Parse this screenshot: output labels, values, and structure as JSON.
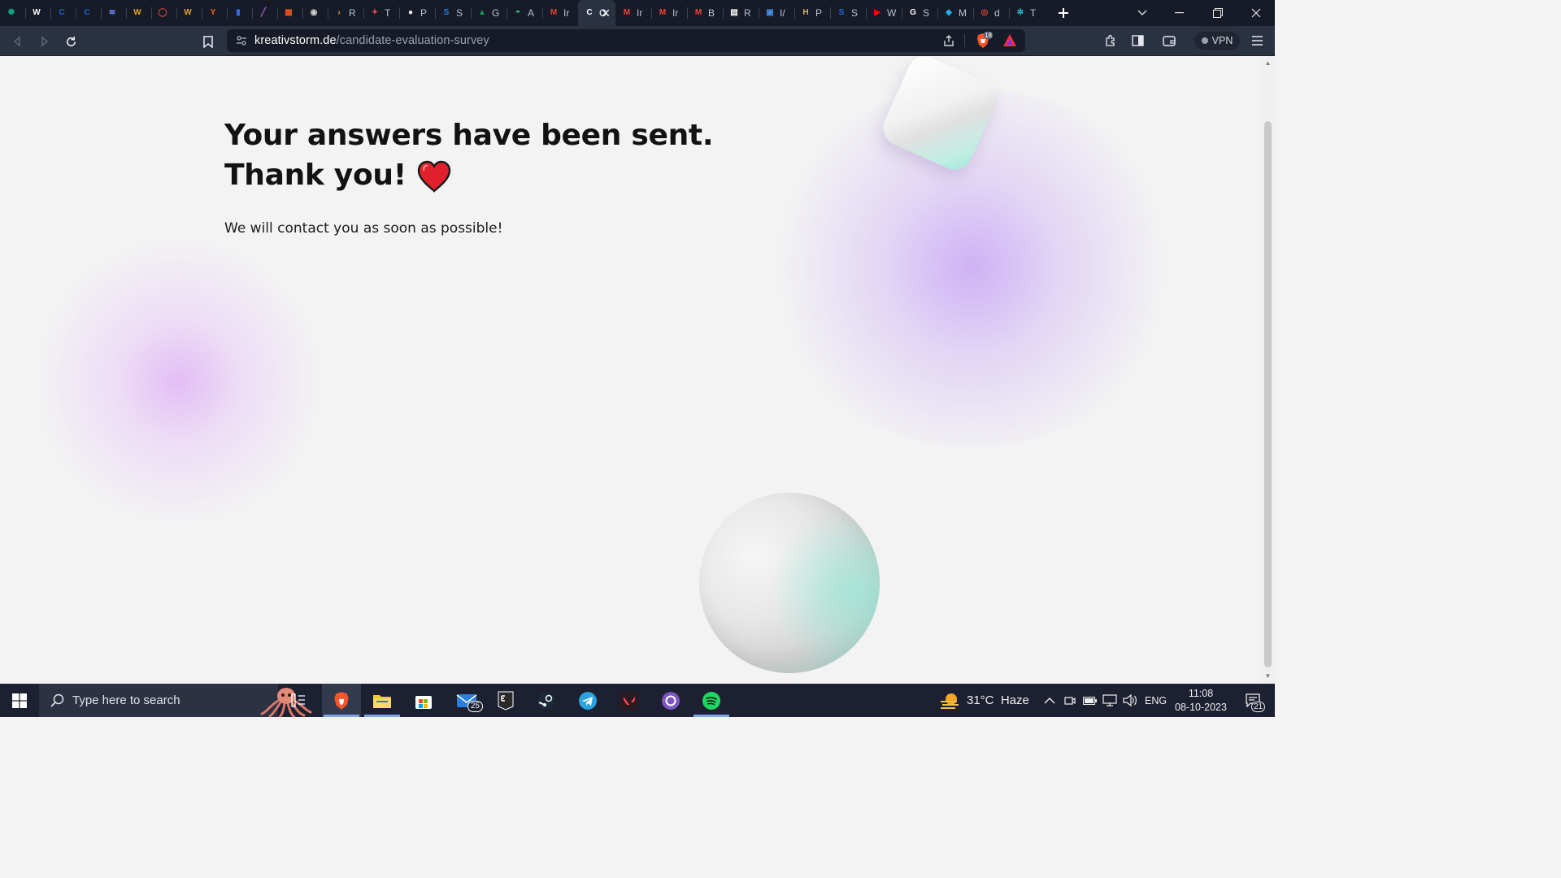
{
  "browser": {
    "tabs": [
      {
        "icon": "openai-icon",
        "title": "",
        "color": "#10a37f"
      },
      {
        "icon": "wordpress-icon",
        "title": "",
        "color": "#ffffff"
      },
      {
        "icon": "c-icon",
        "title": "",
        "color": "#1e63d6"
      },
      {
        "icon": "c-icon",
        "title": "",
        "color": "#1e63d6"
      },
      {
        "icon": "wave-icon",
        "title": "",
        "color": "#6b8cff"
      },
      {
        "icon": "w-icon",
        "title": "",
        "color": "#e8a32a"
      },
      {
        "icon": "ring-icon",
        "title": "",
        "color": "#e0453a"
      },
      {
        "icon": "w-icon",
        "title": "",
        "color": "#e8a32a"
      },
      {
        "icon": "y-icon",
        "title": "",
        "color": "#ff6a00"
      },
      {
        "icon": "book-icon",
        "title": "",
        "color": "#2d6cdf"
      },
      {
        "icon": "slash-icon",
        "title": "",
        "color": "#b05ce0"
      },
      {
        "icon": "microsoft-icon",
        "title": "",
        "color": "#f25022"
      },
      {
        "icon": "globe-icon",
        "title": "",
        "color": "#cfcfcf"
      },
      {
        "icon": "chevron-icon",
        "title": "R",
        "color": "#e8a32a"
      },
      {
        "icon": "pin-icon",
        "title": "T",
        "color": "#e44"
      },
      {
        "icon": "github-icon",
        "title": "P",
        "color": "#ffffff"
      },
      {
        "icon": "s-icon",
        "title": "S",
        "color": "#1e88e5"
      },
      {
        "icon": "drive-icon",
        "title": "G",
        "color": "#0f9d58"
      },
      {
        "icon": "android-icon",
        "title": "A",
        "color": "#3ddc84"
      },
      {
        "icon": "gmail-icon",
        "title": "Ir",
        "color": "#ea4335"
      },
      {
        "icon": "c-icon",
        "title": "C",
        "color": "#ffffff",
        "active": true
      },
      {
        "icon": "gmail-icon",
        "title": "Ir",
        "color": "#ea4335"
      },
      {
        "icon": "gmail-icon",
        "title": "Ir",
        "color": "#ea4335"
      },
      {
        "icon": "gmail-icon",
        "title": "B",
        "color": "#ea4335"
      },
      {
        "icon": "news-icon",
        "title": "R",
        "color": "#ffffff"
      },
      {
        "icon": "contact-icon",
        "title": "I/",
        "color": "#4a90e2"
      },
      {
        "icon": "h-icon",
        "title": "P",
        "color": "#d8b26a"
      },
      {
        "icon": "s-icon",
        "title": "S",
        "color": "#1e6be6"
      },
      {
        "icon": "youtube-icon",
        "title": "W",
        "color": "#ff0000"
      },
      {
        "icon": "google-icon",
        "title": "S",
        "color": "#ffffff"
      },
      {
        "icon": "browser-icon",
        "title": "M",
        "color": "#29b6f6"
      },
      {
        "icon": "record-icon",
        "title": "d",
        "color": "#e0453a"
      },
      {
        "icon": "gear-icon",
        "title": "T",
        "color": "#26c6da"
      }
    ],
    "address": {
      "host": "kreativstorm.de",
      "path": "/candidate-evaluation-survey"
    },
    "shield_count": "18",
    "vpn_label": "VPN"
  },
  "page": {
    "headline_line1": "Your answers have been sent.",
    "headline_line2": "Thank you!",
    "subtext": "We will contact you as soon as possible!",
    "accent_blob": "#d9bff5",
    "heart_color": "#e0202b"
  },
  "taskbar": {
    "search_placeholder": "Type here to search",
    "mail_badge": "25",
    "weather": "31°C  Haze",
    "language": "ENG",
    "time": "11:08",
    "date": "08-10-2023",
    "notification_count": "21"
  }
}
